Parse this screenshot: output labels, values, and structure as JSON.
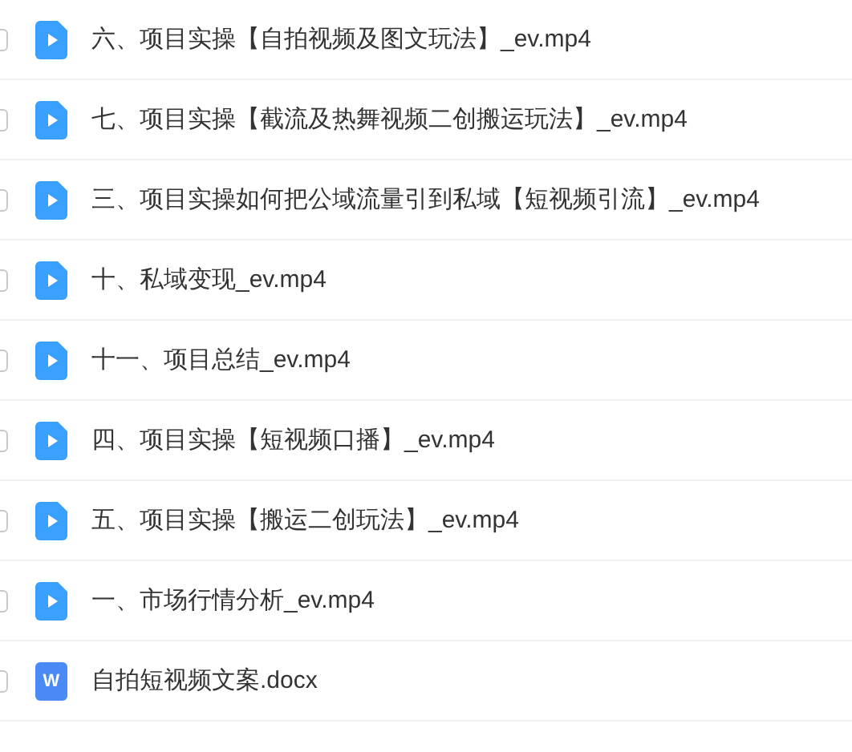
{
  "files": [
    {
      "kind": "video",
      "name": "六、项目实操【自拍视频及图文玩法】_ev.mp4",
      "checked": false
    },
    {
      "kind": "video",
      "name": "七、项目实操【截流及热舞视频二创搬运玩法】_ev.mp4",
      "checked": false
    },
    {
      "kind": "video",
      "name": "三、项目实操如何把公域流量引到私域【短视频引流】_ev.mp4",
      "checked": false
    },
    {
      "kind": "video",
      "name": "十、私域变现_ev.mp4",
      "checked": false
    },
    {
      "kind": "video",
      "name": "十一、项目总结_ev.mp4",
      "checked": false
    },
    {
      "kind": "video",
      "name": "四、项目实操【短视频口播】_ev.mp4",
      "checked": false
    },
    {
      "kind": "video",
      "name": "五、项目实操【搬运二创玩法】_ev.mp4",
      "checked": false
    },
    {
      "kind": "video",
      "name": "一、市场行情分析_ev.mp4",
      "checked": false
    },
    {
      "kind": "doc",
      "name": "自拍短视频文案.docx",
      "badge": "W",
      "checked": false
    }
  ]
}
